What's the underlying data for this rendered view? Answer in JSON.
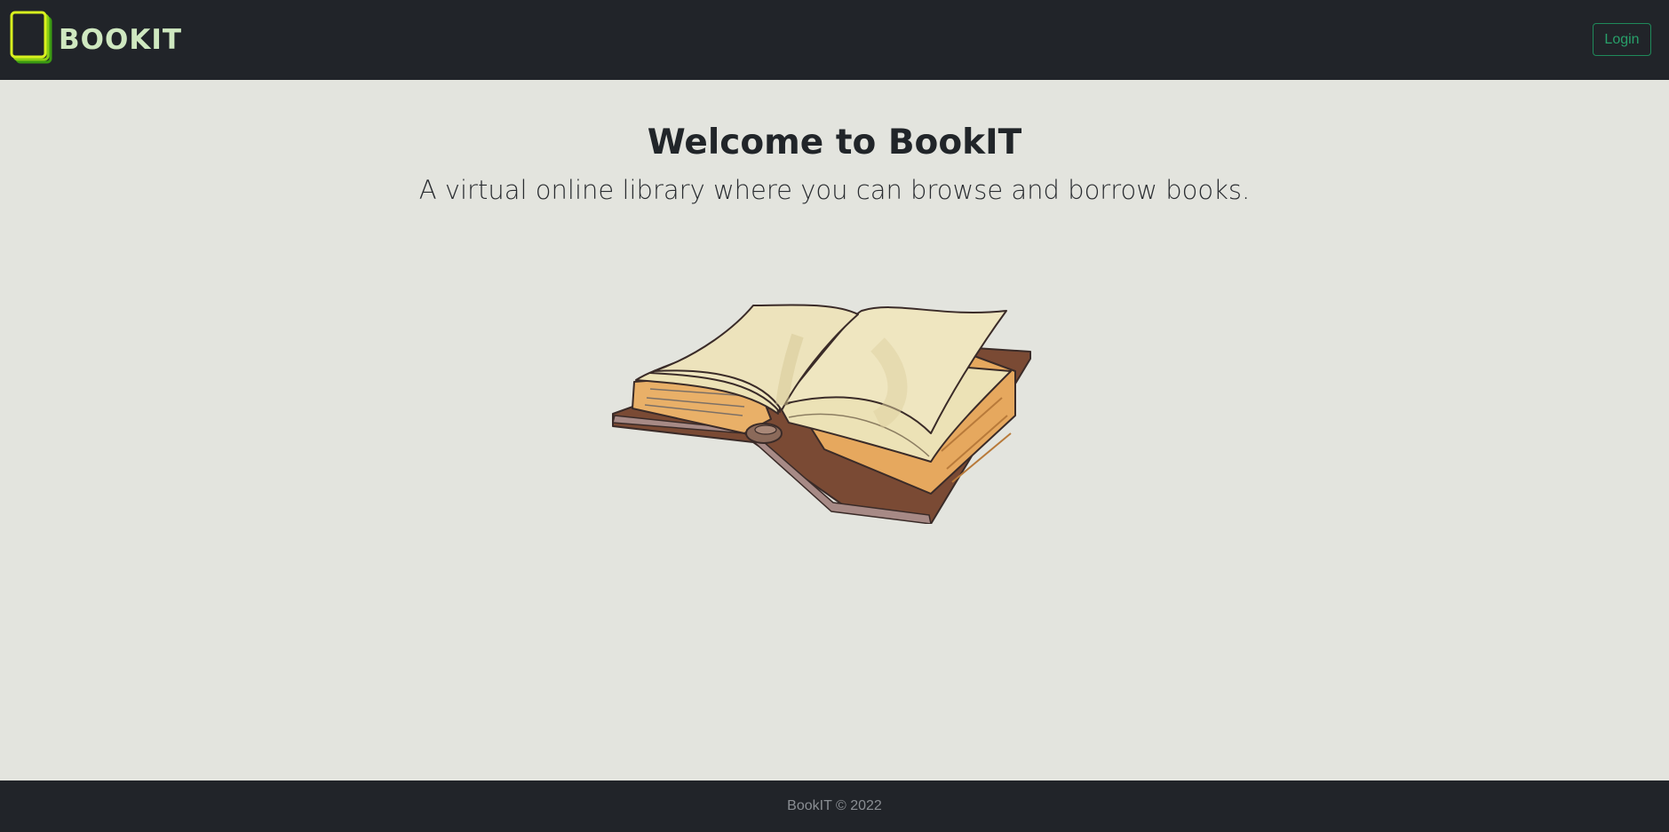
{
  "header": {
    "brand_name": "BOOKIT",
    "brand_logo_icon": "stacked-books-icon",
    "login_label": "Login"
  },
  "hero": {
    "title": "Welcome to BookIT",
    "subtitle": "A virtual online library where you can browse and borrow books.",
    "illustration_icon": "open-book-illustration"
  },
  "footer": {
    "copyright": "BookIT © 2022"
  },
  "colors": {
    "navbar_bg": "#212429",
    "page_bg": "#e3e4de",
    "brand_text": "#cfe8c0",
    "logo_accent": "#c8e61c",
    "login_accent": "#28a06a",
    "footer_text": "#8a8e93"
  }
}
